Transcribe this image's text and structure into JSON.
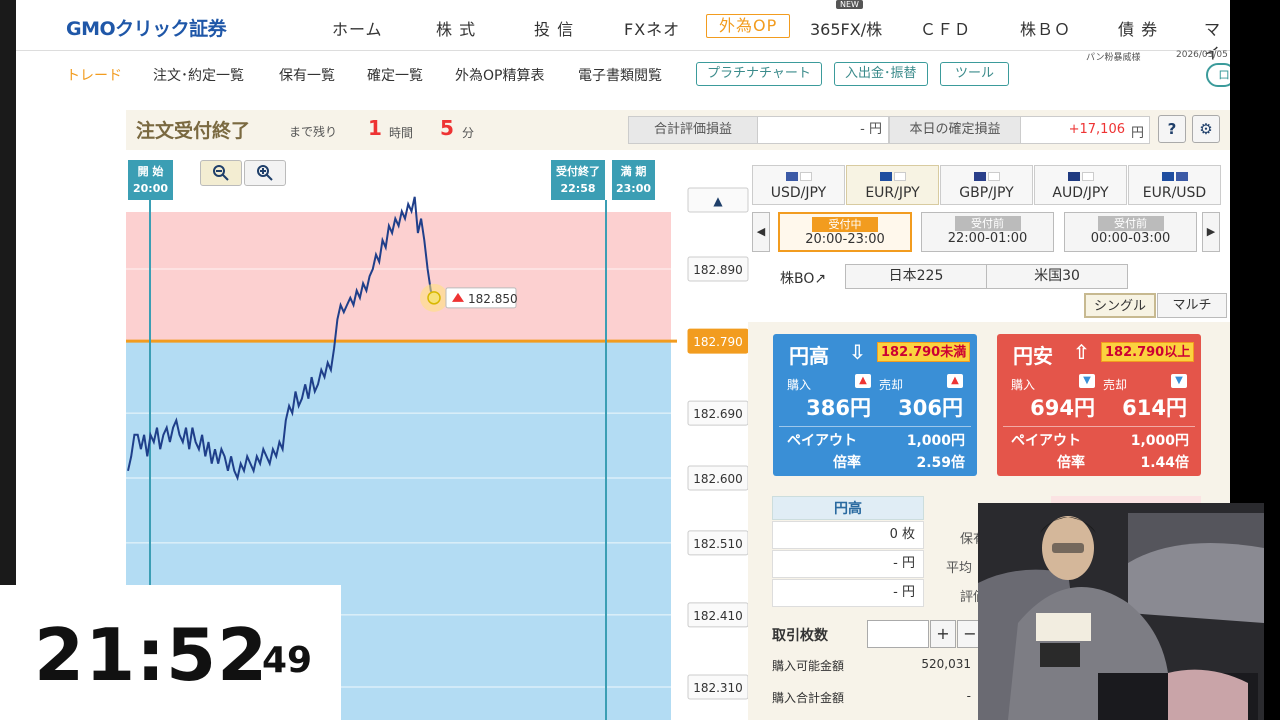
{
  "app": {
    "logo": "GMOクリック証券",
    "user": "パン粉暴威様",
    "date": "2026/03/05"
  },
  "topnav": [
    {
      "label": "ホーム"
    },
    {
      "label": "株 式"
    },
    {
      "label": "投 信"
    },
    {
      "label": "FXネオ"
    },
    {
      "label": "外為OP",
      "active": true
    },
    {
      "label": "365FX/株"
    },
    {
      "label": "ＣＦＤ"
    },
    {
      "label": "株ＢＯ"
    },
    {
      "label": "債 券"
    },
    {
      "label": "マイ"
    }
  ],
  "new_badge": "NEW",
  "subnav": [
    "トレード",
    "注文･約定一覧",
    "保有一覧",
    "確定一覧",
    "外為OP精算表",
    "電子書類閲覧"
  ],
  "subbtns": [
    "プラチナチャート",
    "入出金･振替",
    "ツール"
  ],
  "corner_btn": "ロ",
  "header": {
    "status": "注文受付終了",
    "remain_label": "まで残り",
    "hours": "1",
    "hours_unit": "時間",
    "minutes": "5",
    "minutes_unit": "分",
    "total_pl_label": "合計評価損益",
    "total_pl_value": "- 円",
    "today_pl_label": "本日の確定損益",
    "today_pl_value": "+17,106",
    "today_pl_unit": "円",
    "help_icon": "?",
    "gear_icon": "⚙"
  },
  "chart": {
    "start_flag": {
      "label": "開 始",
      "time": "20:00"
    },
    "close_flag": {
      "label": "受付終了",
      "time": "22:58"
    },
    "expiry_flag": {
      "label": "満 期",
      "time": "23:00"
    },
    "zoom_out": "−",
    "zoom_in": "+",
    "scroll_up": "▲",
    "current_price": "182.850",
    "target_price": "182.790"
  },
  "chart_data": {
    "type": "line",
    "title": "",
    "xlabel": "",
    "ylabel": "",
    "y_ticks": [
      182.89,
      182.79,
      182.69,
      182.6,
      182.51,
      182.41,
      182.31
    ],
    "strike": 182.79,
    "current": 182.85,
    "start_time": "20:00",
    "close_time": "22:58",
    "expiry_time": "23:00",
    "series": [
      {
        "values": [
          182.61,
          182.63,
          182.66,
          182.66,
          182.64,
          182.66,
          182.63,
          182.66,
          182.65,
          182.67,
          182.64,
          182.66,
          182.67,
          182.65,
          182.67,
          182.68,
          182.66,
          182.65,
          182.67,
          182.64,
          182.67,
          182.65,
          182.64,
          182.66,
          182.63,
          182.65,
          182.62,
          182.64,
          182.62,
          182.64,
          182.63,
          182.61,
          182.63,
          182.61,
          182.6,
          182.62,
          182.61,
          182.63,
          182.62,
          182.61,
          182.63,
          182.62,
          182.64,
          182.63,
          182.62,
          182.64,
          182.63,
          182.65,
          182.64,
          182.68,
          182.7,
          182.69,
          182.72,
          182.7,
          182.71,
          182.73,
          182.71,
          182.74,
          182.72,
          182.73,
          182.75,
          182.74,
          182.76,
          182.75,
          182.78,
          182.82,
          182.84,
          182.83,
          182.84,
          182.85,
          182.84,
          182.86,
          182.85,
          182.87,
          182.86,
          182.88,
          182.89,
          182.91,
          182.9,
          182.93,
          182.92,
          182.95,
          182.94,
          182.96,
          182.95,
          182.97,
          182.96,
          182.98,
          182.97,
          182.99,
          182.94,
          182.96,
          182.93,
          182.89,
          182.86,
          182.85
        ]
      }
    ]
  },
  "ccy_tabs": [
    {
      "label": "USD/JPY"
    },
    {
      "label": "EUR/JPY",
      "active": true
    },
    {
      "label": "GBP/JPY"
    },
    {
      "label": "AUD/JPY"
    },
    {
      "label": "EUR/USD"
    }
  ],
  "sessions": [
    {
      "badge": "受付中",
      "time": "20:00-23:00",
      "active": true
    },
    {
      "badge": "受付前",
      "time": "22:00-01:00"
    },
    {
      "badge": "受付前",
      "time": "00:00-03:00"
    }
  ],
  "bo": {
    "label": "株BO↗",
    "buttons": [
      "日本225",
      "米国30"
    ]
  },
  "modes": [
    "シングル",
    "マルチ"
  ],
  "cards": {
    "high": {
      "title": "円高",
      "arrow": "⇩",
      "threshold": "182.790未満",
      "buy_label": "購入",
      "sell_label": "売却",
      "buy_price": "386円",
      "sell_price": "306円",
      "payout_label": "ペイアウト",
      "payout": "1,000円",
      "ratio_label": "倍率",
      "ratio": "2.59倍",
      "color": "#3a8fd6"
    },
    "low": {
      "title": "円安",
      "arrow": "⇧",
      "threshold": "182.790以上",
      "buy_label": "購入",
      "sell_label": "売却",
      "buy_price": "694円",
      "sell_price": "614円",
      "payout_label": "ペイアウト",
      "payout": "1,000円",
      "ratio_label": "倍率",
      "ratio": "1.44倍",
      "color": "#e4554a"
    }
  },
  "position_table": {
    "header": "円高",
    "count": "0 枚",
    "avg": "- 円",
    "eval": "- 円",
    "labels": [
      "保有",
      "平均",
      "評価"
    ]
  },
  "order": {
    "qty_label": "取引枚数",
    "plus": "+",
    "minus": "−",
    "available_label": "購入可能金額",
    "available_value": "520,031",
    "total_label": "購入合計金額",
    "total_value": "-"
  },
  "clock": {
    "hm": "21:52",
    "sec": "49"
  }
}
